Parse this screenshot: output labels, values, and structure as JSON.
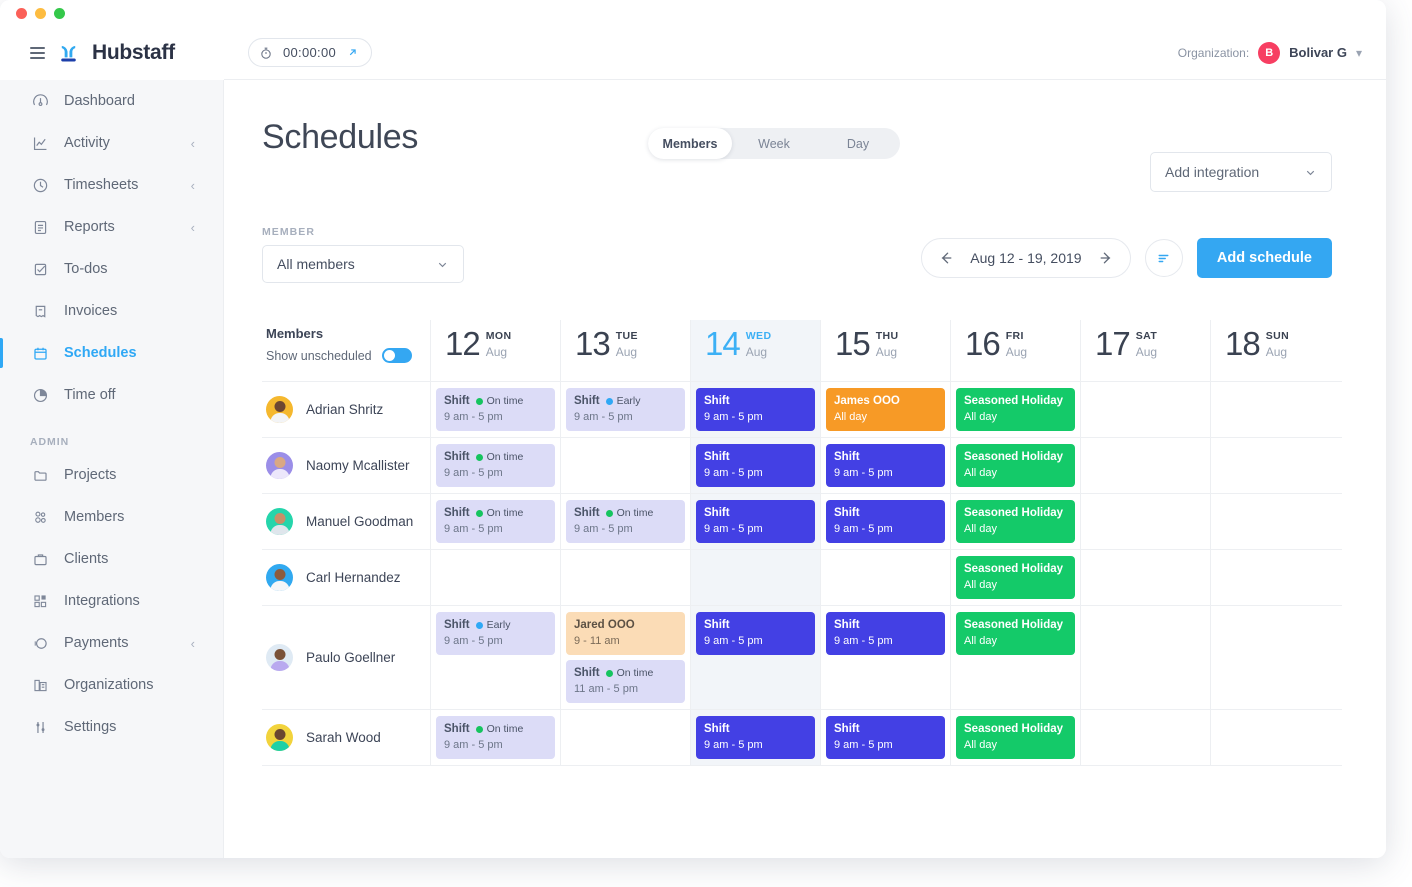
{
  "window": {
    "traffic_lights": [
      "close",
      "minimize",
      "maximize"
    ]
  },
  "topbar": {
    "menu_icon": "hamburger-icon",
    "brand": "Hubstaff",
    "brand_icon": "hubstaff-logo-icon",
    "timer": {
      "icon": "stopwatch-icon",
      "value": "00:00:00",
      "launch_icon": "external-link-icon"
    },
    "org_label": "Organization:",
    "org_initial": "B",
    "org_name": "Bolivar G",
    "org_chevron": "chevron-down-icon"
  },
  "sidebar": {
    "items": [
      {
        "label": "Dashboard",
        "icon": "speedometer-icon",
        "active": false,
        "chevron": false
      },
      {
        "label": "Activity",
        "icon": "chart-line-icon",
        "active": false,
        "chevron": true
      },
      {
        "label": "Timesheets",
        "icon": "clock-icon",
        "active": false,
        "chevron": true
      },
      {
        "label": "Reports",
        "icon": "document-icon",
        "active": false,
        "chevron": true
      },
      {
        "label": "To-dos",
        "icon": "checkbox-icon",
        "active": false,
        "chevron": false
      },
      {
        "label": "Invoices",
        "icon": "invoice-icon",
        "active": false,
        "chevron": false
      },
      {
        "label": "Schedules",
        "icon": "calendar-icon",
        "active": true,
        "chevron": false
      },
      {
        "label": "Time off",
        "icon": "pie-clock-icon",
        "active": false,
        "chevron": false
      }
    ],
    "section_label": "ADMIN",
    "admin_items": [
      {
        "label": "Projects",
        "icon": "folder-icon",
        "active": false,
        "chevron": false
      },
      {
        "label": "Members",
        "icon": "people-icon",
        "active": false,
        "chevron": false
      },
      {
        "label": "Clients",
        "icon": "briefcase-icon",
        "active": false,
        "chevron": false
      },
      {
        "label": "Integrations",
        "icon": "blocks-icon",
        "active": false,
        "chevron": false
      },
      {
        "label": "Payments",
        "icon": "coin-icon",
        "active": false,
        "chevron": true
      },
      {
        "label": "Organizations",
        "icon": "building-icon",
        "active": false,
        "chevron": false
      },
      {
        "label": "Settings",
        "icon": "sliders-icon",
        "active": false,
        "chevron": false
      }
    ]
  },
  "page": {
    "title": "Schedules",
    "view_tabs": [
      {
        "label": "Members",
        "active": true
      },
      {
        "label": "Week",
        "active": false
      },
      {
        "label": "Day",
        "active": false
      }
    ],
    "add_integration_label": "Add integration",
    "member_filter_label": "MEMBER",
    "member_filter_value": "All members",
    "date_range": "Aug 12 - 19, 2019",
    "prev_icon": "arrow-left-icon",
    "next_icon": "arrow-right-icon",
    "filter_icon": "filter-icon",
    "add_schedule_label": "Add schedule"
  },
  "calendar": {
    "members_header": "Members",
    "show_unscheduled_label": "Show unscheduled",
    "show_unscheduled_on": true,
    "days": [
      {
        "num": "12",
        "dow": "MON",
        "month": "Aug",
        "today": false
      },
      {
        "num": "13",
        "dow": "TUE",
        "month": "Aug",
        "today": false
      },
      {
        "num": "14",
        "dow": "WED",
        "month": "Aug",
        "today": true
      },
      {
        "num": "15",
        "dow": "THU",
        "month": "Aug",
        "today": false
      },
      {
        "num": "16",
        "dow": "FRI",
        "month": "Aug",
        "today": false
      },
      {
        "num": "17",
        "dow": "SAT",
        "month": "Aug",
        "today": false
      },
      {
        "num": "18",
        "dow": "SUN",
        "month": "Aug",
        "today": false
      }
    ],
    "rows": [
      {
        "member": "Adrian Shritz",
        "avatar": {
          "bg": "#f5b82e",
          "skin": "#6d4632",
          "shirt": "#f3f4f6"
        },
        "cells": [
          [
            {
              "kind": "shift-light",
              "title": "Shift",
              "status": "On time",
              "status_color": "#16c45f",
              "time": "9 am - 5 pm"
            }
          ],
          [
            {
              "kind": "shift-light",
              "title": "Shift",
              "status": "Early",
              "status_color": "#2fa8f5",
              "time": "9 am - 5 pm"
            }
          ],
          [
            {
              "kind": "shift-solid",
              "title": "Shift",
              "status": "",
              "status_color": "",
              "time": "9 am - 5 pm"
            }
          ],
          [
            {
              "kind": "ooo-solid",
              "title": "James OOO",
              "status": "",
              "status_color": "",
              "time": "All day"
            }
          ],
          [
            {
              "kind": "holiday",
              "title": "Seasoned Holiday",
              "status": "",
              "status_color": "",
              "time": "All day"
            }
          ],
          [],
          []
        ]
      },
      {
        "member": "Naomy Mcallister",
        "avatar": {
          "bg": "#9b8ee8",
          "skin": "#d9a884",
          "shirt": "#ece7fb"
        },
        "cells": [
          [
            {
              "kind": "shift-light",
              "title": "Shift",
              "status": "On time",
              "status_color": "#16c45f",
              "time": "9 am - 5 pm"
            }
          ],
          [],
          [
            {
              "kind": "shift-solid",
              "title": "Shift",
              "status": "",
              "status_color": "",
              "time": "9 am - 5 pm"
            }
          ],
          [
            {
              "kind": "shift-solid",
              "title": "Shift",
              "status": "",
              "status_color": "",
              "time": "9 am - 5 pm"
            }
          ],
          [
            {
              "kind": "holiday",
              "title": "Seasoned Holiday",
              "status": "",
              "status_color": "",
              "time": "All day"
            }
          ],
          [],
          []
        ]
      },
      {
        "member": "Manuel Goodman",
        "avatar": {
          "bg": "#25d5ab",
          "skin": "#c98f68",
          "shirt": "#dfe6ec"
        },
        "cells": [
          [
            {
              "kind": "shift-light",
              "title": "Shift",
              "status": "On time",
              "status_color": "#16c45f",
              "time": "9 am - 5 pm"
            }
          ],
          [
            {
              "kind": "shift-light",
              "title": "Shift",
              "status": "On time",
              "status_color": "#16c45f",
              "time": "9 am - 5 pm"
            }
          ],
          [
            {
              "kind": "shift-solid",
              "title": "Shift",
              "status": "",
              "status_color": "",
              "time": "9 am - 5 pm"
            }
          ],
          [
            {
              "kind": "shift-solid",
              "title": "Shift",
              "status": "",
              "status_color": "",
              "time": "9 am - 5 pm"
            }
          ],
          [
            {
              "kind": "holiday",
              "title": "Seasoned Holiday",
              "status": "",
              "status_color": "",
              "time": "All day"
            }
          ],
          [],
          []
        ]
      },
      {
        "member": "Carl Hernandez",
        "avatar": {
          "bg": "#31a9f0",
          "skin": "#8d5b3d",
          "shirt": "#f4f6f8"
        },
        "cells": [
          [],
          [],
          [],
          [],
          [
            {
              "kind": "holiday",
              "title": "Seasoned Holiday",
              "status": "",
              "status_color": "",
              "time": "All day"
            }
          ],
          [],
          []
        ]
      },
      {
        "member": "Paulo Goellner",
        "avatar": {
          "bg": "#dfeaf4",
          "skin": "#7a5238",
          "shirt": "#b9a9ef"
        },
        "cells": [
          [
            {
              "kind": "shift-light",
              "title": "Shift",
              "status": "Early",
              "status_color": "#2fa8f5",
              "time": "9 am - 5 pm"
            }
          ],
          [
            {
              "kind": "ooo-light",
              "title": "Jared OOO",
              "status": "",
              "status_color": "",
              "time": "9 - 11 am"
            },
            {
              "kind": "shift-light",
              "title": "Shift",
              "status": "On time",
              "status_color": "#16c45f",
              "time": "11 am - 5 pm"
            }
          ],
          [
            {
              "kind": "shift-solid",
              "title": "Shift",
              "status": "",
              "status_color": "",
              "time": "9 am - 5 pm"
            }
          ],
          [
            {
              "kind": "shift-solid",
              "title": "Shift",
              "status": "",
              "status_color": "",
              "time": "9 am - 5 pm"
            }
          ],
          [
            {
              "kind": "holiday",
              "title": "Seasoned Holiday",
              "status": "",
              "status_color": "",
              "time": "All day"
            }
          ],
          [],
          []
        ]
      },
      {
        "member": "Sarah Wood",
        "avatar": {
          "bg": "#f2d33c",
          "skin": "#6b4430",
          "shirt": "#1fd0a6"
        },
        "cells": [
          [
            {
              "kind": "shift-light",
              "title": "Shift",
              "status": "On time",
              "status_color": "#16c45f",
              "time": "9 am - 5 pm"
            }
          ],
          [],
          [
            {
              "kind": "shift-solid",
              "title": "Shift",
              "status": "",
              "status_color": "",
              "time": "9 am - 5 pm"
            }
          ],
          [
            {
              "kind": "shift-solid",
              "title": "Shift",
              "status": "",
              "status_color": "",
              "time": "9 am - 5 pm"
            }
          ],
          [
            {
              "kind": "holiday",
              "title": "Seasoned Holiday",
              "status": "",
              "status_color": "",
              "time": "All day"
            }
          ],
          [],
          []
        ]
      }
    ]
  },
  "colors": {
    "accent_blue": "#34a7f2",
    "shift_solid": "#4340e4",
    "shift_light": "#dcdcf7",
    "holiday_green": "#14ca69",
    "ooo_orange": "#f79a26",
    "ooo_light": "#fbdcb6",
    "brand_red": "#f73e62"
  }
}
